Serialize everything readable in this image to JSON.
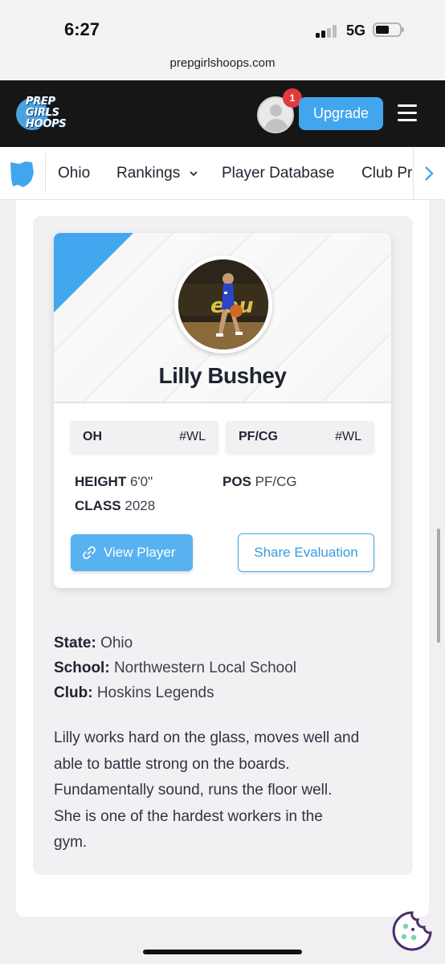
{
  "status": {
    "time": "6:27",
    "network": "5G"
  },
  "browser": {
    "url": "prepgirlshoops.com"
  },
  "header": {
    "logo_lines": [
      "PREP",
      "GIRLS",
      "HOOPS"
    ],
    "notification_count": "1",
    "upgrade_label": "Upgrade"
  },
  "nav": {
    "items": [
      {
        "label": "Ohio"
      },
      {
        "label": "Rankings"
      },
      {
        "label": "Player Database"
      },
      {
        "label": "Club Pr"
      }
    ]
  },
  "player": {
    "name": "Lilly Bushey",
    "tags": [
      {
        "label": "OH",
        "rank": "#WL"
      },
      {
        "label": "PF/CG",
        "rank": "#WL"
      }
    ],
    "height_label": "HEIGHT",
    "height": "6'0\"",
    "pos_label": "POS",
    "pos": "PF/CG",
    "class_label": "CLASS",
    "class": "2028",
    "view_label": "View Player",
    "share_label": "Share Evaluation"
  },
  "evaluation": {
    "state_label": "State:",
    "state": "Ohio",
    "school_label": "School:",
    "school": "Northwestern Local School",
    "club_label": "Club:",
    "club": "Hoskins Legends",
    "lines": [
      "Lilly works hard on the glass, moves well and",
      "able to battle strong on the boards.",
      "Fundamentally sound, runs the floor well.",
      "She is one of the hardest workers in the",
      "gym."
    ]
  },
  "colors": {
    "accent": "#42a6ee",
    "header_bg": "#161616",
    "badge": "#e03a3e"
  }
}
